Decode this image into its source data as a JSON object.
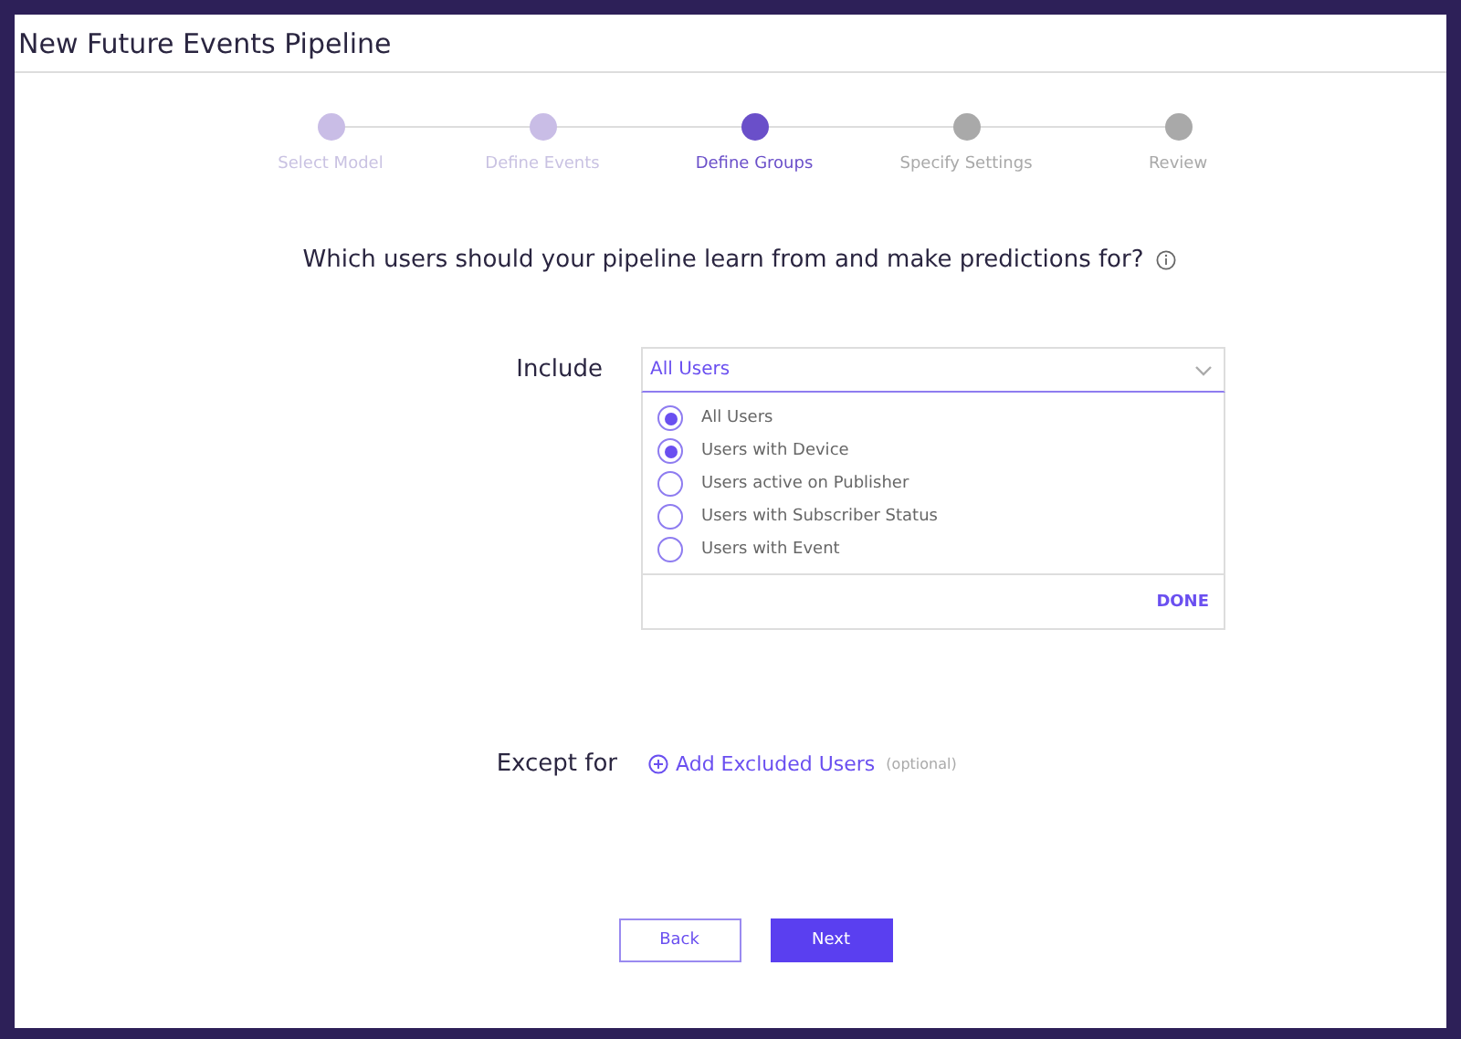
{
  "window": {
    "title": "New Future Events Pipeline"
  },
  "steps": [
    {
      "label": "Select Model",
      "kind": "done"
    },
    {
      "label": "Define Events",
      "kind": "done"
    },
    {
      "label": "Define Groups",
      "kind": "current"
    },
    {
      "label": "Specify Settings",
      "kind": "upcoming"
    },
    {
      "label": "Review",
      "kind": "upcoming"
    }
  ],
  "question": "Which users should your pipeline learn from and make predictions for?",
  "include": {
    "label": "Include",
    "value": "All Users",
    "options": [
      {
        "label": "All Users",
        "checked": true
      },
      {
        "label": "Users with Device",
        "checked": true
      },
      {
        "label": "Users active on Publisher",
        "checked": false
      },
      {
        "label": "Users with Subscriber Status",
        "checked": false
      },
      {
        "label": "Users with Event",
        "checked": false
      }
    ],
    "done": "DONE"
  },
  "except": {
    "label": "Except for",
    "link": "Add Excluded Users",
    "hint": "(optional)"
  },
  "buttons": [
    {
      "label": "Back",
      "kind": "secondary"
    },
    {
      "label": "Next",
      "kind": "primary"
    }
  ]
}
